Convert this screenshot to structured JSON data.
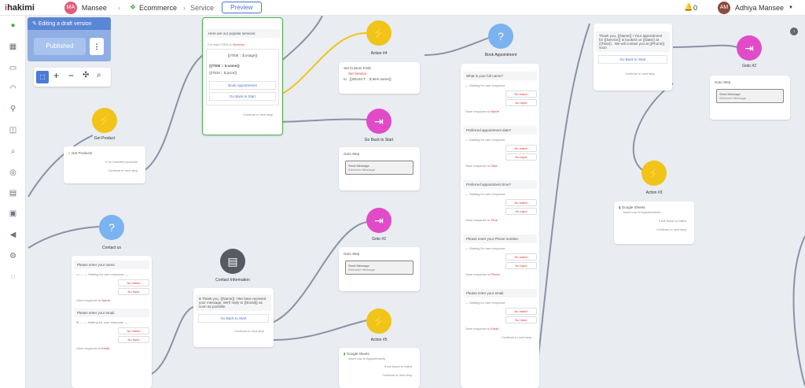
{
  "topbar": {
    "logo": "hakimi",
    "workspace_avatar": "MA",
    "workspace_name": "Mansee",
    "flow_group": "Ecommerce",
    "flow_name": "Service",
    "preview_label": "Preview",
    "notifications_count": "0",
    "user_avatar": "AM",
    "user_name": "Adhiya Mansee",
    "colors": {
      "ws_avatar": "#e35b7a",
      "user_avatar": "#8a4a3d"
    }
  },
  "draft_panel": {
    "editing_label": "Editing a draft version",
    "published_label": "Published",
    "more_label": "⋮"
  },
  "sidebar_icons": [
    "chat-icon",
    "grid-icon",
    "message-icon",
    "headset-icon",
    "user-icon",
    "columns-icon",
    "search-people-icon",
    "globe-icon",
    "table-icon",
    "archive-icon",
    "megaphone-icon",
    "settings-icon",
    "chat-bubble-icon"
  ],
  "colors": {
    "action": "#f0c419",
    "goto": "#e14bc8",
    "question": "#7ab3f0",
    "contact": "#555a63",
    "line": "#8a92a5",
    "active_line": "#f0c419",
    "selected_card": "#4caf50"
  },
  "nodes": {
    "get_product": {
      "title": "Get Product",
      "field": "Get Products",
      "row1": "If no matched products",
      "row2": "Continue to next step"
    },
    "services": {
      "intro": "Here are our popular services:",
      "foreach": "For each ITEM in",
      "foreach_var": "Services",
      "image": "{{ITEM :: $.image}}",
      "name": "{{ITEM :: $.name}}",
      "price": "{{ITEM :: $.price}}",
      "btn1": "Book Appointment",
      "btn2": "Go Back to Start",
      "continue": "Continue to next step"
    },
    "action4": {
      "title": "Action #4",
      "label": "Set Custom Field",
      "field": "Set Service",
      "to": "to",
      "value": "{{SELECT :: $.item.name}}"
    },
    "go_back_start": {
      "title": "Go Back to Start",
      "goto": "Goto Step",
      "msg": "Send Message",
      "sub": "Welcome Message"
    },
    "goto2": {
      "title": "Goto #2",
      "goto": "Goto Step",
      "msg": "Send Message",
      "sub": "Welcome Message"
    },
    "action5": {
      "title": "Action #5",
      "sheet": "Google sheets",
      "sub": "Insert row to Appointments",
      "row1": "If not found or failed",
      "row2": "Continue to next step"
    },
    "contact_us": {
      "title": "Contact us",
      "q1": "Please enter your name.",
      "q2": "Please enter your email.",
      "waiting": "Waiting for user response",
      "no_match": "No match",
      "no_input": "No input",
      "save1": "Save response to",
      "var1": "Name",
      "var2": "Email"
    },
    "contact_info": {
      "title": "Contact Information",
      "msg": "Thank you, {{Name}} ! We have received your message. We'll reply to {{Email}} as soon as possible",
      "btn": "Go Back to Start",
      "continue": "Continue to next step"
    },
    "book": {
      "title": "Book Appointment",
      "q1": "What is your full name?",
      "q2": "Preferred appointment date?",
      "q3": "Preferred appointment time?",
      "q4": "Please enter your Phone number.",
      "q5": "Please enter your email.",
      "waiting": "Waiting for user response",
      "no_match": "No match",
      "no_input": "No input",
      "save": "Save response to",
      "vars": [
        "Name",
        "Date",
        "Time",
        "Phone",
        "Email"
      ],
      "continue": "Continue to next step"
    },
    "confirm": {
      "msg": "Thank you, {{Name}} ! Your appointment for {{Service}} is booked on {{Date}} at {{Time}} . We will contact you at {{Phone}} soon",
      "btn": "Go Back to Start",
      "continue": "Continue to next step"
    },
    "goto3": {
      "title": "Goto #2",
      "goto": "Goto Step",
      "msg": "Send Message",
      "sub": "Welcome Message"
    },
    "action3": {
      "title": "Action #3",
      "sheet": "Google Sheets",
      "sub": "Insert row to Appointments",
      "row1": "If not found or failed",
      "row2": "Continue to next step"
    }
  }
}
